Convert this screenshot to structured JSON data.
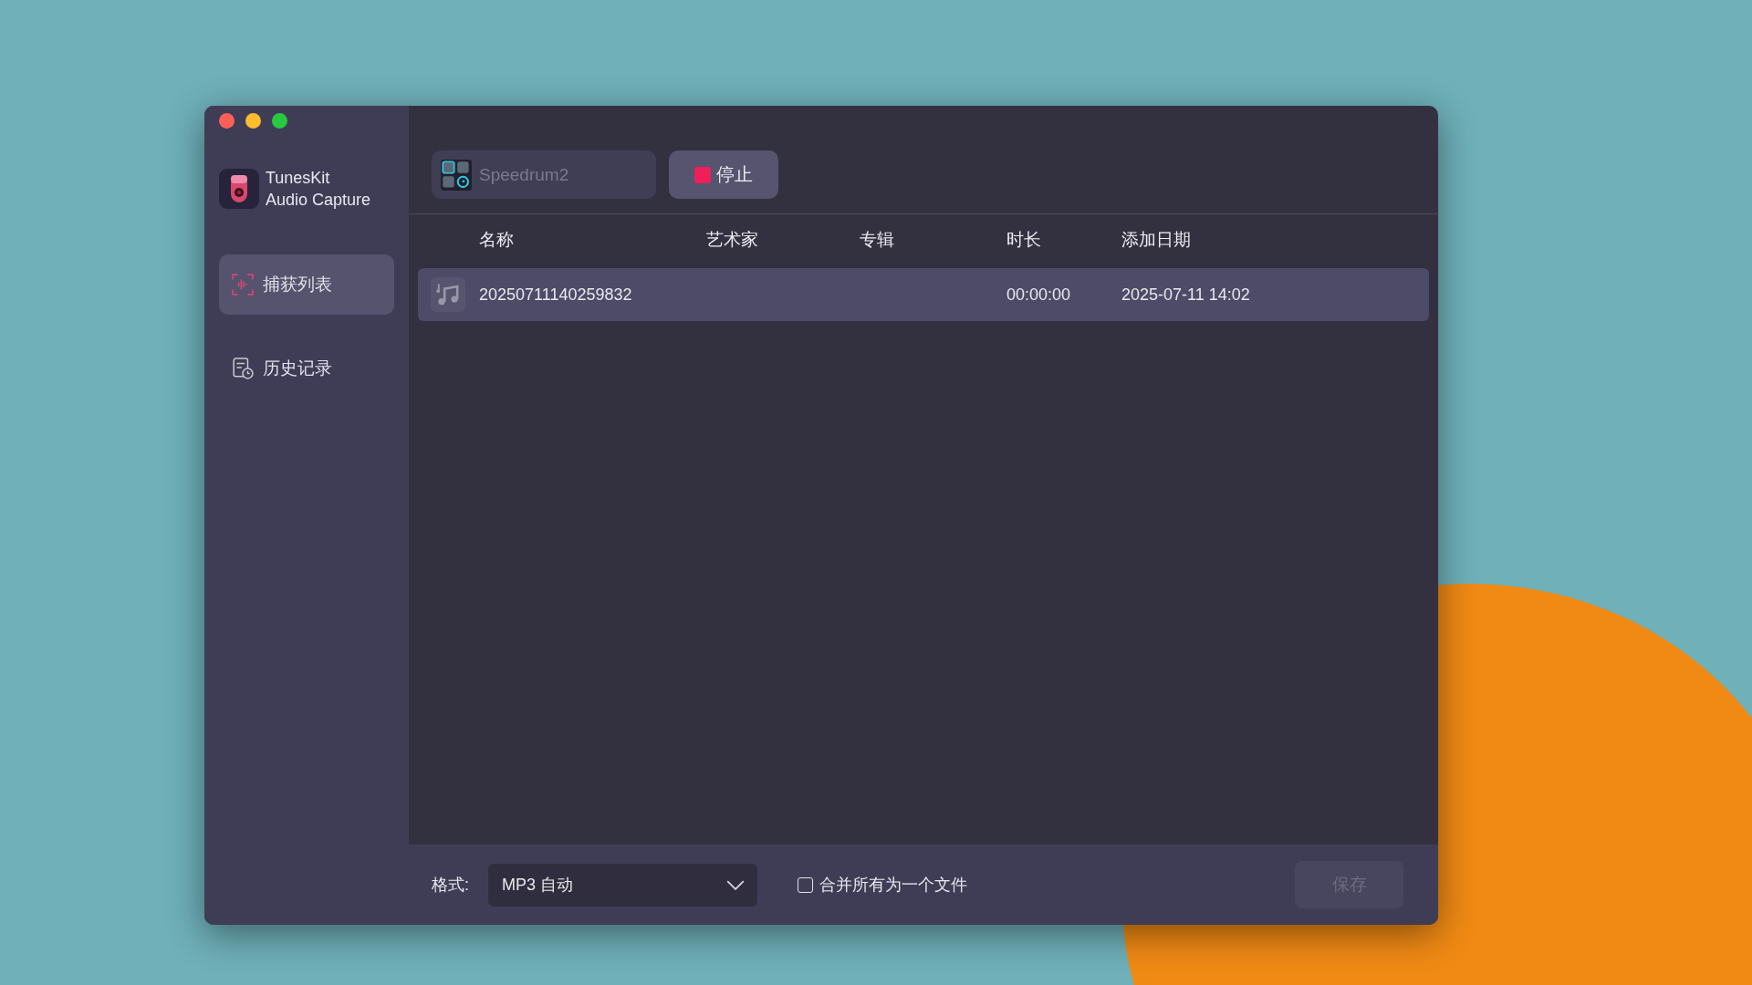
{
  "app": {
    "name_line1": "TunesKit",
    "name_line2": "Audio Capture"
  },
  "sidebar": {
    "items": [
      {
        "label": "捕获列表",
        "kind": "capture",
        "selected": true
      },
      {
        "label": "历史记录",
        "kind": "history",
        "selected": false
      }
    ]
  },
  "toolbar": {
    "source_app": "Speedrum2",
    "stop_button": "停止"
  },
  "table": {
    "columns": [
      "名称",
      "艺术家",
      "专辑",
      "时长",
      "添加日期"
    ],
    "rows": [
      {
        "name": "20250711140259832",
        "artist": "",
        "album": "",
        "duration": "00:00:00",
        "date": "2025-07-11 14:02",
        "selected": true
      }
    ]
  },
  "footer": {
    "format_label": "格式:",
    "format_value": "MP3 自动",
    "merge_label": "合并所有为一个文件",
    "merge_checked": false,
    "save_button": "保存",
    "save_disabled": true
  }
}
